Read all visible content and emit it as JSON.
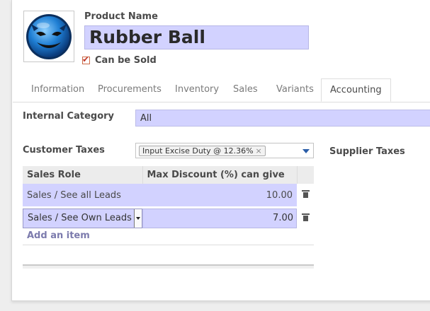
{
  "product": {
    "name_label": "Product Name",
    "name": "Rubber Ball",
    "can_be_sold_label": "Can be Sold",
    "can_be_sold": true,
    "image_icon": "devil-smiley-avatar"
  },
  "tabs": [
    {
      "label": "Information",
      "active": false
    },
    {
      "label": "Procurements",
      "active": false
    },
    {
      "label": "Inventory",
      "active": false
    },
    {
      "label": "Sales",
      "active": false
    },
    {
      "label": "Variants",
      "active": false
    },
    {
      "label": "Accounting",
      "active": true
    }
  ],
  "accounting": {
    "internal_category_label": "Internal Category",
    "internal_category_value": "All",
    "customer_taxes_label": "Customer Taxes",
    "customer_tax_tag": "Input Excise Duty @ 12.36%",
    "tag_remove_glyph": "×",
    "supplier_taxes_label": "Supplier Taxes"
  },
  "roles_table": {
    "columns": [
      "Sales Role",
      "Max Discount (%) can give"
    ],
    "rows": [
      {
        "role": "Sales / See all Leads",
        "discount": "10.00"
      },
      {
        "role": "Sales / See Own Leads",
        "discount": "7.00"
      }
    ],
    "add_item_label": "Add an item"
  },
  "colors": {
    "required_field_bg": "#d2d2ff",
    "link": "#7c7bad",
    "checkbox_tick": "#c0392b"
  }
}
